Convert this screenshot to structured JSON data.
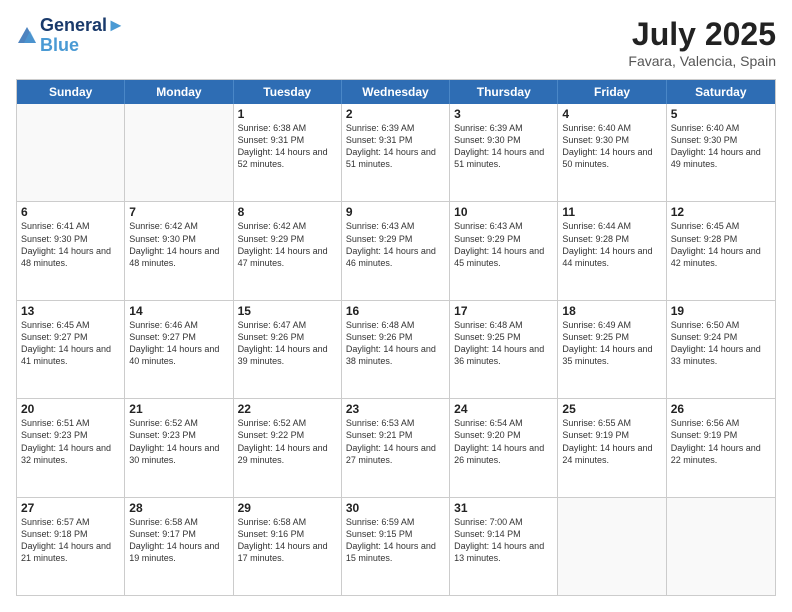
{
  "header": {
    "logo_line1": "General",
    "logo_line2": "Blue",
    "month_year": "July 2025",
    "location": "Favara, Valencia, Spain"
  },
  "weekdays": [
    "Sunday",
    "Monday",
    "Tuesday",
    "Wednesday",
    "Thursday",
    "Friday",
    "Saturday"
  ],
  "weeks": [
    [
      {
        "day": "",
        "info": ""
      },
      {
        "day": "",
        "info": ""
      },
      {
        "day": "1",
        "info": "Sunrise: 6:38 AM\nSunset: 9:31 PM\nDaylight: 14 hours and 52 minutes."
      },
      {
        "day": "2",
        "info": "Sunrise: 6:39 AM\nSunset: 9:31 PM\nDaylight: 14 hours and 51 minutes."
      },
      {
        "day": "3",
        "info": "Sunrise: 6:39 AM\nSunset: 9:30 PM\nDaylight: 14 hours and 51 minutes."
      },
      {
        "day": "4",
        "info": "Sunrise: 6:40 AM\nSunset: 9:30 PM\nDaylight: 14 hours and 50 minutes."
      },
      {
        "day": "5",
        "info": "Sunrise: 6:40 AM\nSunset: 9:30 PM\nDaylight: 14 hours and 49 minutes."
      }
    ],
    [
      {
        "day": "6",
        "info": "Sunrise: 6:41 AM\nSunset: 9:30 PM\nDaylight: 14 hours and 48 minutes."
      },
      {
        "day": "7",
        "info": "Sunrise: 6:42 AM\nSunset: 9:30 PM\nDaylight: 14 hours and 48 minutes."
      },
      {
        "day": "8",
        "info": "Sunrise: 6:42 AM\nSunset: 9:29 PM\nDaylight: 14 hours and 47 minutes."
      },
      {
        "day": "9",
        "info": "Sunrise: 6:43 AM\nSunset: 9:29 PM\nDaylight: 14 hours and 46 minutes."
      },
      {
        "day": "10",
        "info": "Sunrise: 6:43 AM\nSunset: 9:29 PM\nDaylight: 14 hours and 45 minutes."
      },
      {
        "day": "11",
        "info": "Sunrise: 6:44 AM\nSunset: 9:28 PM\nDaylight: 14 hours and 44 minutes."
      },
      {
        "day": "12",
        "info": "Sunrise: 6:45 AM\nSunset: 9:28 PM\nDaylight: 14 hours and 42 minutes."
      }
    ],
    [
      {
        "day": "13",
        "info": "Sunrise: 6:45 AM\nSunset: 9:27 PM\nDaylight: 14 hours and 41 minutes."
      },
      {
        "day": "14",
        "info": "Sunrise: 6:46 AM\nSunset: 9:27 PM\nDaylight: 14 hours and 40 minutes."
      },
      {
        "day": "15",
        "info": "Sunrise: 6:47 AM\nSunset: 9:26 PM\nDaylight: 14 hours and 39 minutes."
      },
      {
        "day": "16",
        "info": "Sunrise: 6:48 AM\nSunset: 9:26 PM\nDaylight: 14 hours and 38 minutes."
      },
      {
        "day": "17",
        "info": "Sunrise: 6:48 AM\nSunset: 9:25 PM\nDaylight: 14 hours and 36 minutes."
      },
      {
        "day": "18",
        "info": "Sunrise: 6:49 AM\nSunset: 9:25 PM\nDaylight: 14 hours and 35 minutes."
      },
      {
        "day": "19",
        "info": "Sunrise: 6:50 AM\nSunset: 9:24 PM\nDaylight: 14 hours and 33 minutes."
      }
    ],
    [
      {
        "day": "20",
        "info": "Sunrise: 6:51 AM\nSunset: 9:23 PM\nDaylight: 14 hours and 32 minutes."
      },
      {
        "day": "21",
        "info": "Sunrise: 6:52 AM\nSunset: 9:23 PM\nDaylight: 14 hours and 30 minutes."
      },
      {
        "day": "22",
        "info": "Sunrise: 6:52 AM\nSunset: 9:22 PM\nDaylight: 14 hours and 29 minutes."
      },
      {
        "day": "23",
        "info": "Sunrise: 6:53 AM\nSunset: 9:21 PM\nDaylight: 14 hours and 27 minutes."
      },
      {
        "day": "24",
        "info": "Sunrise: 6:54 AM\nSunset: 9:20 PM\nDaylight: 14 hours and 26 minutes."
      },
      {
        "day": "25",
        "info": "Sunrise: 6:55 AM\nSunset: 9:19 PM\nDaylight: 14 hours and 24 minutes."
      },
      {
        "day": "26",
        "info": "Sunrise: 6:56 AM\nSunset: 9:19 PM\nDaylight: 14 hours and 22 minutes."
      }
    ],
    [
      {
        "day": "27",
        "info": "Sunrise: 6:57 AM\nSunset: 9:18 PM\nDaylight: 14 hours and 21 minutes."
      },
      {
        "day": "28",
        "info": "Sunrise: 6:58 AM\nSunset: 9:17 PM\nDaylight: 14 hours and 19 minutes."
      },
      {
        "day": "29",
        "info": "Sunrise: 6:58 AM\nSunset: 9:16 PM\nDaylight: 14 hours and 17 minutes."
      },
      {
        "day": "30",
        "info": "Sunrise: 6:59 AM\nSunset: 9:15 PM\nDaylight: 14 hours and 15 minutes."
      },
      {
        "day": "31",
        "info": "Sunrise: 7:00 AM\nSunset: 9:14 PM\nDaylight: 14 hours and 13 minutes."
      },
      {
        "day": "",
        "info": ""
      },
      {
        "day": "",
        "info": ""
      }
    ]
  ]
}
